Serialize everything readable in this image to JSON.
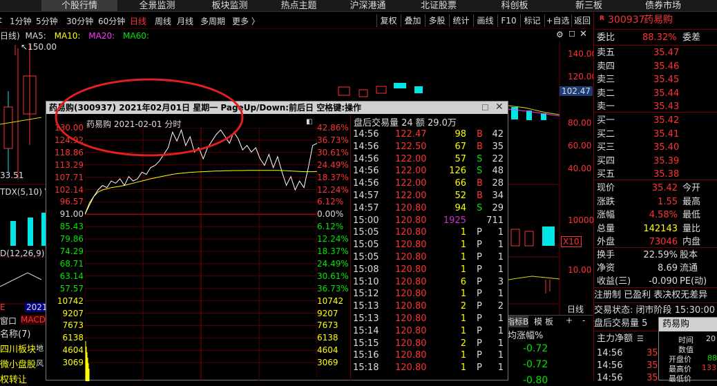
{
  "top_tabs": [
    "个股行情",
    "全景监测",
    "板块监测",
    "热点主题",
    "沪深港通",
    "北证股票",
    "科创板",
    "新三板",
    "债券市场"
  ],
  "periods": [
    "1分钟",
    "5分钟",
    "30分钟",
    "60分钟",
    "日线",
    "周线",
    "月线",
    "多周期",
    "更多 〉"
  ],
  "toolbar": [
    "复权",
    "叠加",
    "多股",
    "统计",
    "画线",
    "F10",
    "标记",
    "+自选",
    "返回"
  ],
  "ma": {
    "prefix": "日线)",
    "ma5": "MA5:",
    "ma10": "MA10:",
    "ma20": "MA20:",
    "ma60": "MA60:"
  },
  "kline": {
    "high_label": "150.00",
    "low_label": "33.51",
    "right_axis": [
      "140.00",
      "120.00",
      "102.47",
      "80.00",
      "60.00",
      "40.00",
      "10000",
      "X10",
      "10.00"
    ],
    "ind_tdx": "TDX(5,10)  V",
    "ind_macd": "D(12,26,9)  D",
    "date_tag": "2021/",
    "date_e": "E",
    "day_btn": "日线"
  },
  "left_list": {
    "tabs": [
      "窗口",
      "MACD"
    ],
    "header": "名称(7)",
    "items": [
      "四川板块",
      "微小盘股",
      "权转让"
    ],
    "tags": [
      "地",
      "风",
      ""
    ]
  },
  "stock": {
    "code": "300937",
    "name": "药易购"
  },
  "right_panel": {
    "weibi": {
      "label": "委比",
      "value": "88.32%",
      "label2": "委差"
    },
    "sell": [
      {
        "label": "卖五",
        "price": "35.47"
      },
      {
        "label": "卖四",
        "price": "35.46"
      },
      {
        "label": "卖三",
        "price": "35.45"
      },
      {
        "label": "卖二",
        "price": "35.44"
      },
      {
        "label": "卖一",
        "price": "35.43"
      }
    ],
    "buy": [
      {
        "label": "买一",
        "price": "35.42"
      },
      {
        "label": "买二",
        "price": "35.41"
      },
      {
        "label": "买三",
        "price": "35.40"
      },
      {
        "label": "买四",
        "price": "35.39"
      },
      {
        "label": "买五",
        "price": "35.38"
      }
    ],
    "quote": [
      {
        "l": "现价",
        "v": "35.42",
        "l2": "今开",
        "vc": "red"
      },
      {
        "l": "涨跌",
        "v": "1.55",
        "l2": "最高",
        "vc": "red"
      },
      {
        "l": "涨幅",
        "v": "4.58%",
        "l2": "最低",
        "vc": "red"
      },
      {
        "l": "总量",
        "v": "142143",
        "l2": "量比",
        "vc": "yellow"
      },
      {
        "l": "外盘",
        "v": "73046",
        "l2": "内盘",
        "vc": "red"
      }
    ],
    "stats": [
      {
        "l": "换手",
        "v": "22.59%",
        "l2": "股本"
      },
      {
        "l": "净资",
        "v": "8.69",
        "l2": "流通"
      },
      {
        "l": "收益(三)",
        "v": "-0.090",
        "l2": "PE(动)"
      }
    ],
    "reg": "注册制 已盈利 表决权无差异",
    "status": "交易状态: 闭市阶段 15:30:00",
    "after": "盘后交易量 5",
    "netflow": "主力净额",
    "tick_times": [
      "14:56",
      "14:56",
      "14:56"
    ],
    "tick_prices": [
      "35",
      "35",
      "35"
    ]
  },
  "small_popup": {
    "name": "药易购",
    "rows": [
      "时间",
      "数值",
      "开盘价",
      "最高价",
      "最低价"
    ],
    "vals": [
      "20",
      "",
      "88",
      "133",
      ""
    ]
  },
  "popup": {
    "title": "药易购(300937)  2021年02月01日  星期一  PageUp/Down:前后日  空格键:操作",
    "chart_header": "药易购   2021-02-01  分时",
    "left_axis": [
      "130.00",
      "124.92",
      "118.86",
      "113.29",
      "107.71",
      "102.14",
      "96.57",
      "91.00",
      "85.43",
      "79.86",
      "74.29",
      "68.71",
      "63.14",
      "57.57",
      "10742",
      "9207",
      "7673",
      "6138",
      "4604",
      "3069"
    ],
    "right_axis": [
      "42.86%",
      "36.73%",
      "30.61%",
      "24.49%",
      "18.37%",
      "12.24%",
      "6.12%",
      "0.00%",
      "6.12%",
      "12.24%",
      "18.37%",
      "24.49%",
      "30.61%",
      "36.73%",
      "10742",
      "9207",
      "7673",
      "6138",
      "4604",
      "3069"
    ],
    "trade_header": "盘后交易量 24  额 29.0万",
    "trades": [
      [
        "14:56",
        "122.47",
        "98",
        "B",
        "42"
      ],
      [
        "14:56",
        "122.50",
        "67",
        "B",
        "35"
      ],
      [
        "14:56",
        "122.00",
        "57",
        "S",
        "22"
      ],
      [
        "14:56",
        "122.00",
        "126",
        "S",
        "48"
      ],
      [
        "14:56",
        "122.00",
        "66",
        "B",
        "28"
      ],
      [
        "14:57",
        "122.00",
        "52",
        "B",
        "34"
      ],
      [
        "14:57",
        "120.80",
        "94",
        "S",
        "29"
      ],
      [
        "15:00",
        "120.80",
        "1925",
        "",
        "711"
      ],
      [
        "15:05",
        "120.80",
        "1",
        "P",
        "1"
      ],
      [
        "15:05",
        "120.80",
        "1",
        "P",
        "1"
      ],
      [
        "15:05",
        "120.80",
        "1",
        "P",
        "1"
      ],
      [
        "15:08",
        "120.80",
        "1",
        "P",
        "1"
      ],
      [
        "15:10",
        "120.80",
        "6",
        "P",
        "3"
      ],
      [
        "15:12",
        "120.80",
        "1",
        "P",
        "1"
      ],
      [
        "15:13",
        "120.80",
        "2",
        "P",
        "2"
      ],
      [
        "15:13",
        "120.80",
        "1",
        "P",
        "1"
      ],
      [
        "15:14",
        "120.80",
        "1",
        "P",
        "1"
      ],
      [
        "15:15",
        "120.80",
        "2",
        "P",
        "1"
      ],
      [
        "15:16",
        "120.80",
        "1",
        "P",
        "1"
      ],
      [
        "15:18",
        "120.80",
        "1",
        "P",
        "1"
      ]
    ]
  },
  "list_bottom": {
    "tabs": [
      "指标B",
      "模",
      "板",
      "+",
      "-"
    ],
    "col": "均涨幅%",
    "vals": [
      "-0.72",
      "-0.72",
      "-0.80"
    ]
  },
  "chart_data": {
    "type": "line",
    "title": "药易购   2021-02-01  分时",
    "ylim": [
      57.57,
      130.0
    ],
    "pre_close": 91.0,
    "series": [
      {
        "values": [
          91.0,
          95,
          99,
          102,
          104,
          103,
          106,
          105,
          107,
          104,
          108,
          106,
          107,
          110,
          109,
          112,
          113,
          115,
          118,
          121,
          128,
          124,
          129,
          122,
          126,
          119,
          121,
          116,
          121,
          124,
          127,
          129,
          126,
          123,
          128,
          125,
          120,
          122,
          119,
          121,
          116,
          113,
          118,
          112,
          117,
          110,
          104,
          108,
          102,
          106,
          103,
          112,
          122,
          123
        ]
      },
      {
        "values": [
          91.0,
          96,
          99,
          101,
          102,
          102.5,
          103,
          103.3,
          103.6,
          104,
          104.5,
          105,
          105.5,
          106,
          106.5,
          107,
          107.4,
          107.8,
          108.2,
          108.6,
          109,
          109.3,
          109.5,
          109.7,
          109.9,
          110,
          110.1,
          110.2,
          110.3,
          110.4,
          110.5,
          110.5,
          110.6,
          110.6,
          110.7,
          110.7,
          110.7,
          110.8,
          110.8,
          110.8,
          110.8,
          110.8,
          110.8,
          110.8,
          110.8,
          110.7,
          110.6,
          110.5,
          110.4,
          110.3,
          110.2,
          110.2,
          110.2,
          110.3
        ]
      }
    ]
  },
  "colors": {
    "up": "#ff3333",
    "down": "#00e600",
    "avg": "#ffff00",
    "grid": "#5a0000",
    "bg": "#000000"
  }
}
